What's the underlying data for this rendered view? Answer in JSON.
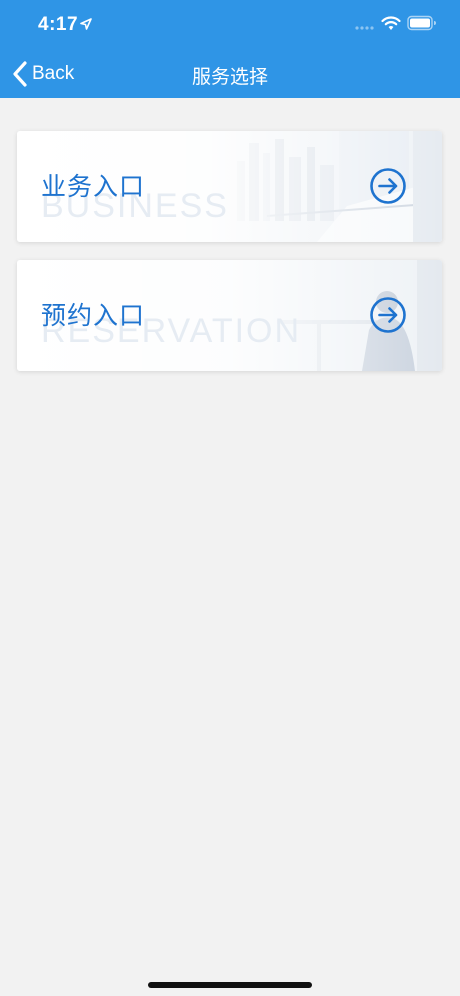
{
  "status_bar": {
    "time": "4:17"
  },
  "nav": {
    "back_label": "Back",
    "title": "服务选择"
  },
  "cards": [
    {
      "label": "业务入口",
      "watermark": "BUSINESS"
    },
    {
      "label": "预约入口",
      "watermark": "RESERVATION"
    }
  ],
  "colors": {
    "header": "#2f95e6",
    "accent": "#1e73cf",
    "background": "#f2f2f2"
  },
  "icons": {
    "back": "chevron-left-icon",
    "card_arrow": "arrow-right-circle-icon",
    "location": "location-arrow-icon",
    "wifi": "wifi-icon",
    "battery": "battery-icon"
  }
}
